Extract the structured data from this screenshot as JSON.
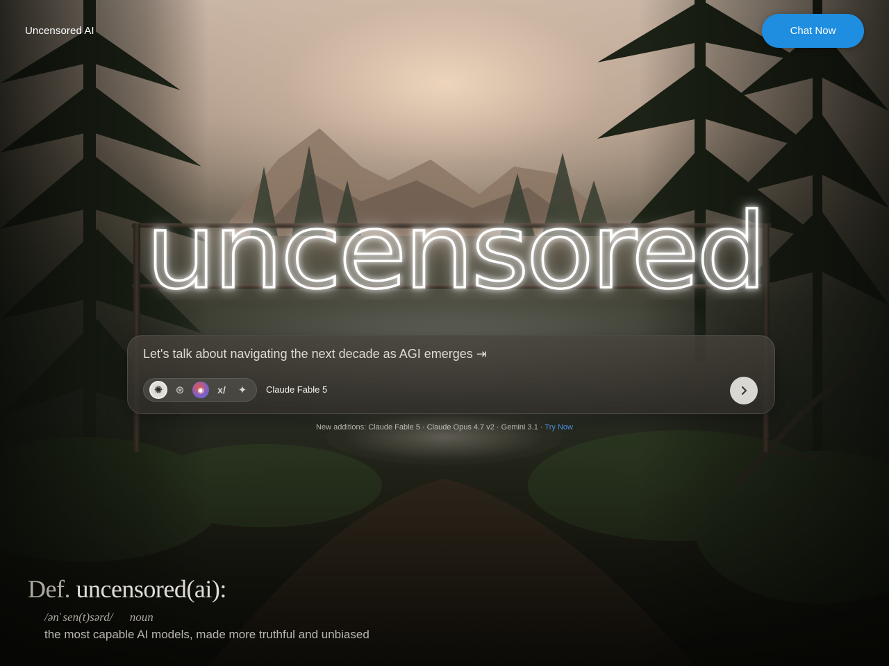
{
  "header": {
    "brand": "Uncensored AI",
    "cta_label": "Chat Now"
  },
  "hero": {
    "neon_word": "uncensored"
  },
  "prompt": {
    "text": "Let's talk about navigating the next decade as AGI emerges ⇥",
    "selected_model": "Claude Fable 5",
    "model_icons": [
      "claude-icon",
      "openai-icon",
      "gemini-icon",
      "xai-icon",
      "sparkle-icon"
    ]
  },
  "additions": {
    "prefix": "New additions:",
    "items": [
      "Claude Fable 5",
      "Claude Opus 4.7 v2",
      "Gemini 3.1"
    ],
    "link": "Try Now"
  },
  "definition": {
    "prefix": "Def.",
    "term": "uncensored(ai):",
    "pronunciation": "/ənˈsen(t)sərd/",
    "part_of_speech": "noun",
    "meaning": "the most capable AI models, made more truthful and unbiased"
  },
  "colors": {
    "accent": "#1f8de0",
    "neon": "#ffffff"
  }
}
